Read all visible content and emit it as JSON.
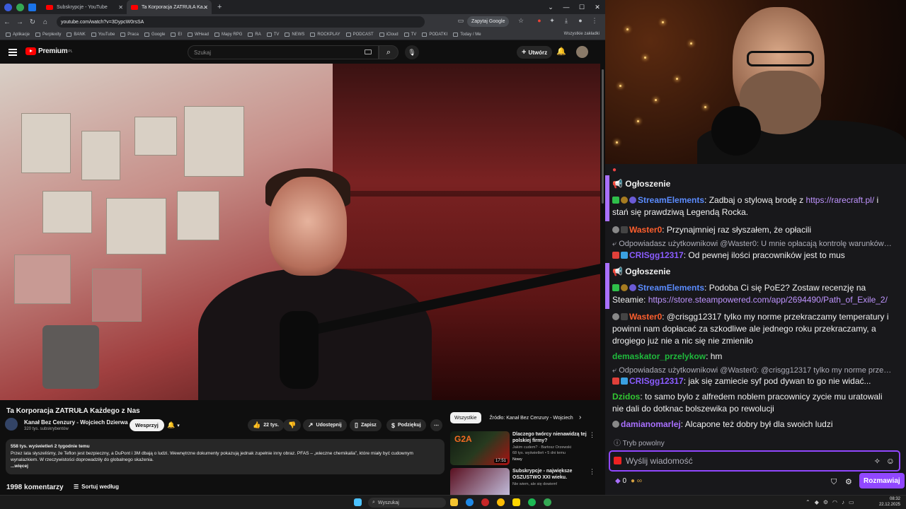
{
  "browser": {
    "tabs": [
      {
        "label": "Subskrypcje - YouTube"
      },
      {
        "label": "Ta Korporacja ZATRUŁA Ka..."
      }
    ],
    "url": "youtube.com/watch?v=3DypcW0rsSA",
    "ask_google": "Zapytaj Google",
    "bookmarks": [
      "Aplikacje",
      "Perplexity",
      "BANK",
      "YouTube",
      "Praca",
      "Google",
      "EI",
      "WHead",
      "Mapy RPG",
      "RA",
      "TV",
      "NEWS",
      "ROCKPLAY",
      "PODCAST",
      "iCloud",
      "TV",
      "PODATKI",
      "Today / Me"
    ],
    "bookmarks_all": "Wszystkie zakładki"
  },
  "yt": {
    "logo": "Premium",
    "logo_sup": "PL",
    "search_placeholder": "Szukaj",
    "create": "Utwórz"
  },
  "video": {
    "title": "Ta Korporacja ZATRUŁA Każdego z Nas",
    "channel": "Kanał Bez Cenzury - Wojciech Dzierwa",
    "subs": "320 tys. subskrybentów",
    "join": "Wesprzyj",
    "likes": "22 tys.",
    "share": "Udostępnij",
    "save": "Zapisz",
    "thanks": "Podziękuj",
    "views_meta": "558 tys. wyświetleń  2 tygodnie temu",
    "description": "Przez lata słyszeliśmy, że Teflon jest bezpieczny, a DuPont i 3M dbają o ludzi. Wewnętrzne dokumenty pokazują jednak zupełnie inny obraz. PFAS – „wieczne chemikalia”, które miały być cudownym wynalazkiem. W rzeczywistości doprowadziły do globalnego skażenia.",
    "more": "...więcej",
    "comments": "1998 komentarzy",
    "sort": "Sortuj według"
  },
  "sidebar": {
    "chips": [
      "Wszystkie",
      "Źródło: Kanał Bez Cenzury - Wojciech"
    ],
    "recs": [
      {
        "title": "Dlaczego twórcy nienawidzą tej polskiej firmy?",
        "channel": "Jakim cudem? - Bartosz Orzewski",
        "meta": "68 tys. wyświetleń • 5 dni temu",
        "badge": "Nowy",
        "duration": "17:51",
        "thumb_text": "G2A"
      },
      {
        "title": "Subskrypcje - największe OSZUSTWO XXI wieku.",
        "channel": "Nie wiem, ale się dowiem!",
        "meta": "",
        "badge": "",
        "duration": "",
        "thumb_text": ""
      }
    ]
  },
  "chat": {
    "ann1_title": "Ogłoszenie",
    "ann1_user": "StreamElements",
    "ann1_text": ": Zadbaj o stylową brodę z ",
    "ann1_link": "https://rarecraft.pl/",
    "ann1_text2": " i stań się prawdziwą Legendą Rocka.",
    "m1_user": "Waster0",
    "m1_text": ": Przynajmniej raz słyszałem, że opłacili",
    "r1": "Odpowiadasz użytkownikowi @Waster0: U mnie opłacają kontrolę warunków pr...",
    "m2_user": "CRISgg12317",
    "m2_text": ": Od pewnej ilości pracowników jest to mus",
    "ann2_title": "Ogłoszenie",
    "ann2_user": "StreamElements",
    "ann2_text": ": Podoba Ci się PoE2? Zostaw recenzję na Steamie: ",
    "ann2_link": "https://store.steampowered.com/app/2694490/Path_of_Exile_2/",
    "m3_user": "Waster0",
    "m3_text": ": @crisgg12317 tylko my norme przekraczamy temperatury i powinni nam dopłacać za szkodliwe ale jednego roku przekraczamy, a drogiego już nie a nic się nie zmieniło",
    "m4_user": "demaskator_przelykow",
    "m4_text": ": hm",
    "r2": "Odpowiadasz użytkownikowi @Waster0: @crisgg12317 tylko my norme przekra...",
    "m5_user": "CRISgg12317",
    "m5_text": ": jak się zamiecie syf pod dywan to go nie widać...",
    "m6_user": "Dzidos",
    "m6_text": ": to samo bylo z alfredem noblem pracownicy zycie mu uratowali nie dali do dotknac bolszewika po rewolucji",
    "m7_user": "damianomarlej",
    "m7_text": ": Alcapone też dobry był dla swoich ludzi",
    "slow": "Tryb powolny",
    "input_placeholder": "Wyślij wiadomość",
    "bits": "0",
    "send": "Rozmawiaj"
  },
  "taskbar": {
    "search": "Wyszukaj",
    "time": "08:32",
    "date": "22.12.2025"
  },
  "colors": {
    "accent": "#9147ff",
    "yt_red": "#ff0000",
    "streamelements": "#5b8cff",
    "waster": "#ff5f2e",
    "cris": "#8a5cff",
    "demask": "#1fba3c",
    "dzidos": "#32c832",
    "damiano": "#a970ff"
  }
}
